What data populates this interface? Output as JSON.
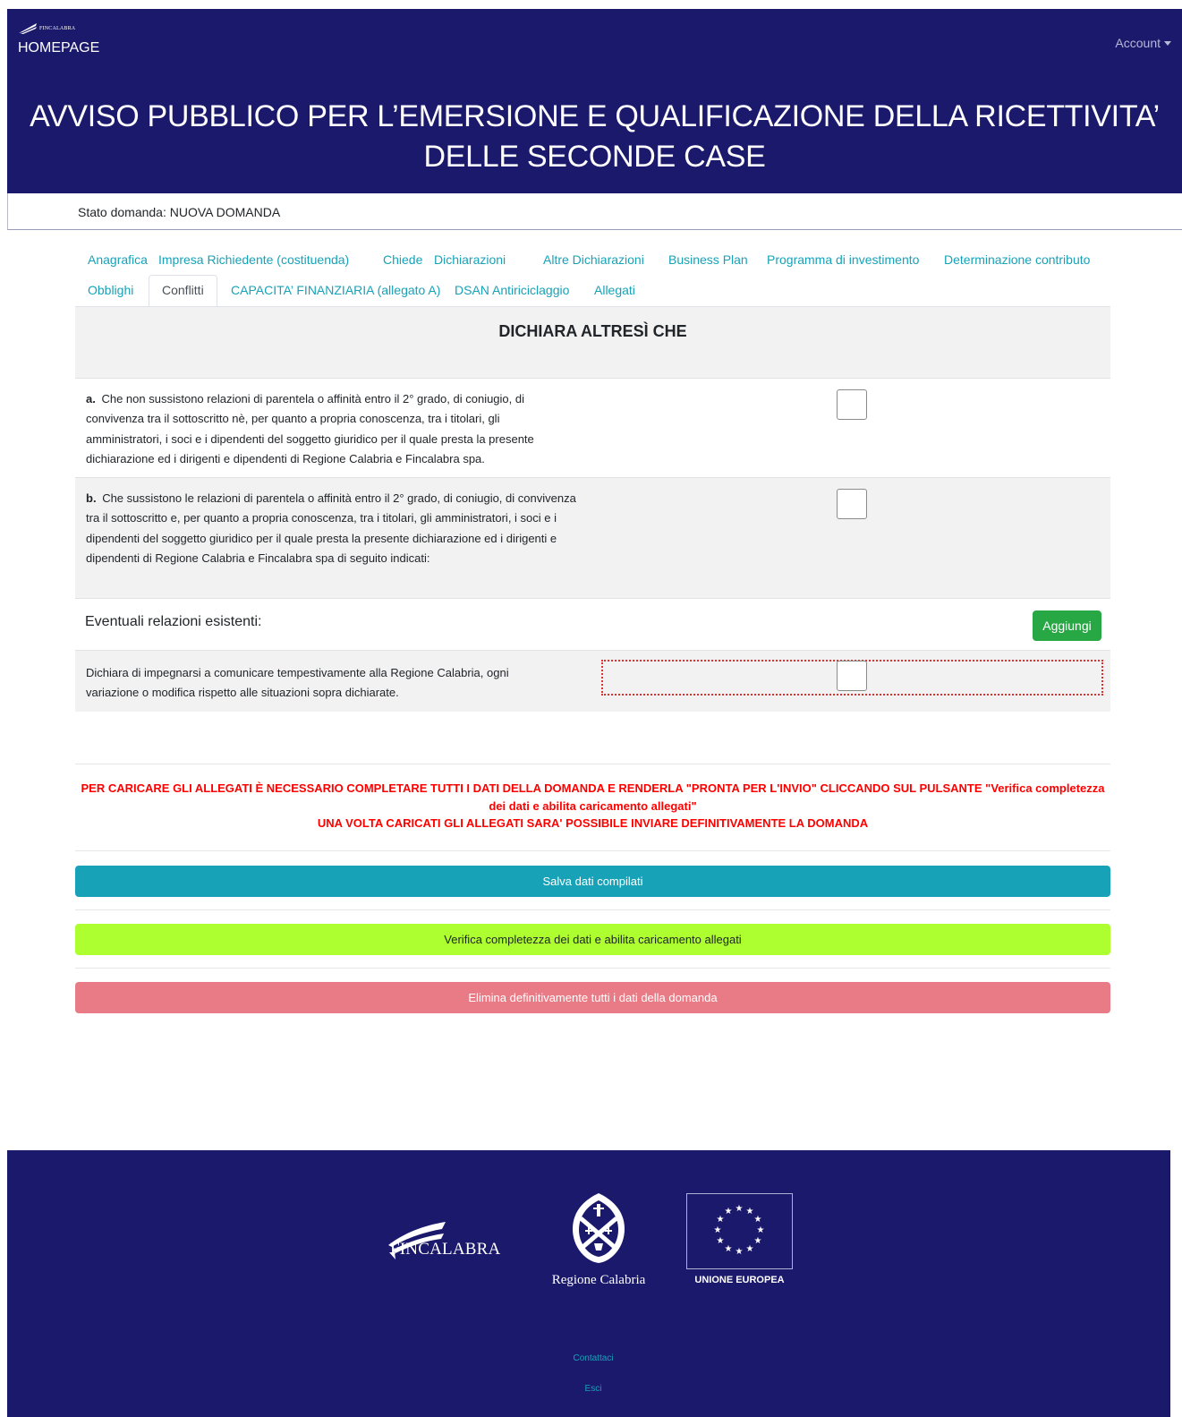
{
  "navbar": {
    "brand_small": "FINCALABRA",
    "home_label": "HOMEPAGE",
    "account_label": "Account",
    "title": "AVVISO PUBBLICO PER L’EMERSIONE E QUALIFICAZIONE DELLA RICETTIVITA’ DELLE SECONDE CASE"
  },
  "status": {
    "text": "Stato domanda: NUOVA DOMANDA"
  },
  "tabs": {
    "row1": [
      "Anagrafica",
      "Impresa Richiedente (costituenda)",
      "Chiede",
      "Dichiarazioni",
      "Altre Dichiarazioni",
      "Business Plan",
      "Programma di investimento",
      "Determinazione contributo"
    ],
    "row2": [
      "Obblighi",
      "Conflitti",
      "CAPACITA’ FINANZIARIA (allegato A)",
      "DSAN Antiriciclaggio",
      "Allegati"
    ],
    "active": "Conflitti"
  },
  "section": {
    "heading": "DICHIARA ALTRESÌ CHE",
    "item_a_label": "a.",
    "item_a_text": "Che non sussistono relazioni di parentela o affinità entro il 2° grado, di coniugio, di convivenza tra il sottoscritto nè, per quanto a propria conoscenza, tra i titolari, gli amministratori, i soci e i dipendenti del soggetto giuridico per il quale presta la presente dichiarazione ed i dirigenti e dipendenti di Regione Calabria e Fincalabra spa.",
    "item_b_label": "b.",
    "item_b_text": "Che sussistono le relazioni di parentela o affinità entro il 2° grado, di coniugio, di convivenza tra il sottoscritto e, per quanto a propria conoscenza, tra i titolari, gli amministratori, i soci e i dipendenti del soggetto giuridico per il quale presta la presente dichiarazione ed i dirigenti e dipendenti di Regione Calabria e Fincalabra spa di seguito indicati:",
    "relations_label": "Eventuali relazioni esistenti:",
    "add_button": "Aggiungi",
    "commit_text": "Dichiara di impegnarsi a comunicare tempestivamente alla Regione Calabria, ogni variazione o modifica rispetto alle situazioni sopra dichiarate."
  },
  "warning": {
    "line1": "PER CARICARE GLI ALLEGATI È NECESSARIO COMPLETARE TUTTI I DATI DELLA DOMANDA E RENDERLA \"PRONTA PER L'INVIO\" CLICCANDO SUL PULSANTE \"Verifica completezza dei dati e abilita caricamento allegati\"",
    "line2": "UNA VOLTA CARICATI GLI ALLEGATI SARA' POSSIBILE INVIARE DEFINITIVAMENTE LA DOMANDA"
  },
  "actions": {
    "save": "Salva dati compilati",
    "verify": "Verifica completezza dei dati e abilita caricamento allegati",
    "delete": "Elimina definitivamente tutti i dati della domanda"
  },
  "footer": {
    "fincalabra": "FINCALABRA",
    "regione": "Regione Calabria",
    "eu": "UNIONE EUROPEA",
    "contact": "Contattaci",
    "logout": "Esci"
  },
  "colors": {
    "navy": "#1b196b",
    "link": "#17a2b8",
    "save": "#17a2b8",
    "verify": "#adff2f",
    "delete": "#e87b85",
    "warning": "#ff0000",
    "add": "#28a745"
  },
  "icons": [
    "fincalabra-logo-icon",
    "caret-down-icon",
    "regione-calabria-crest-icon",
    "eu-flag-icon"
  ]
}
